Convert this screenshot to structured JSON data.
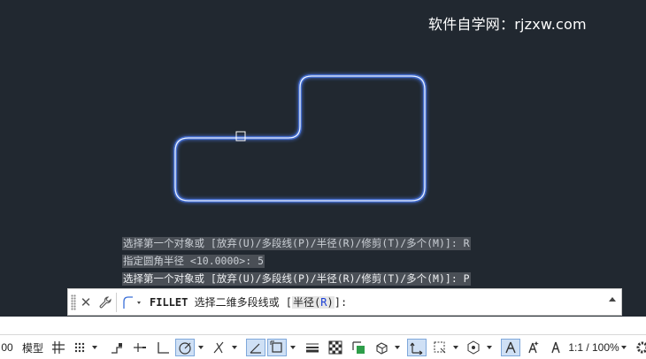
{
  "watermark": "软件自学网：rjzxw.com",
  "history": [
    "选择第一个对象或 [放弃(U)/多段线(P)/半径(R)/修剪(T)/多个(M)]: R",
    "指定圆角半径 <10.0000>: 5",
    "选择第一个对象或 [放弃(U)/多段线(P)/半径(R)/修剪(T)/多个(M)]: P"
  ],
  "command": {
    "name": "FILLET",
    "prompt": " 选择二维多段线或 [",
    "option_label": "半径(",
    "option_key": "R",
    "option_close": ")",
    "suffix": "]:"
  },
  "statusbar": {
    "coord_tail": "00",
    "model_label": "模型",
    "scale_label": "1:1 / 100%"
  },
  "colors": {
    "canvas": "#212830",
    "selection_glow": "#6f9bff",
    "selection_core": "#e8f0ff"
  }
}
